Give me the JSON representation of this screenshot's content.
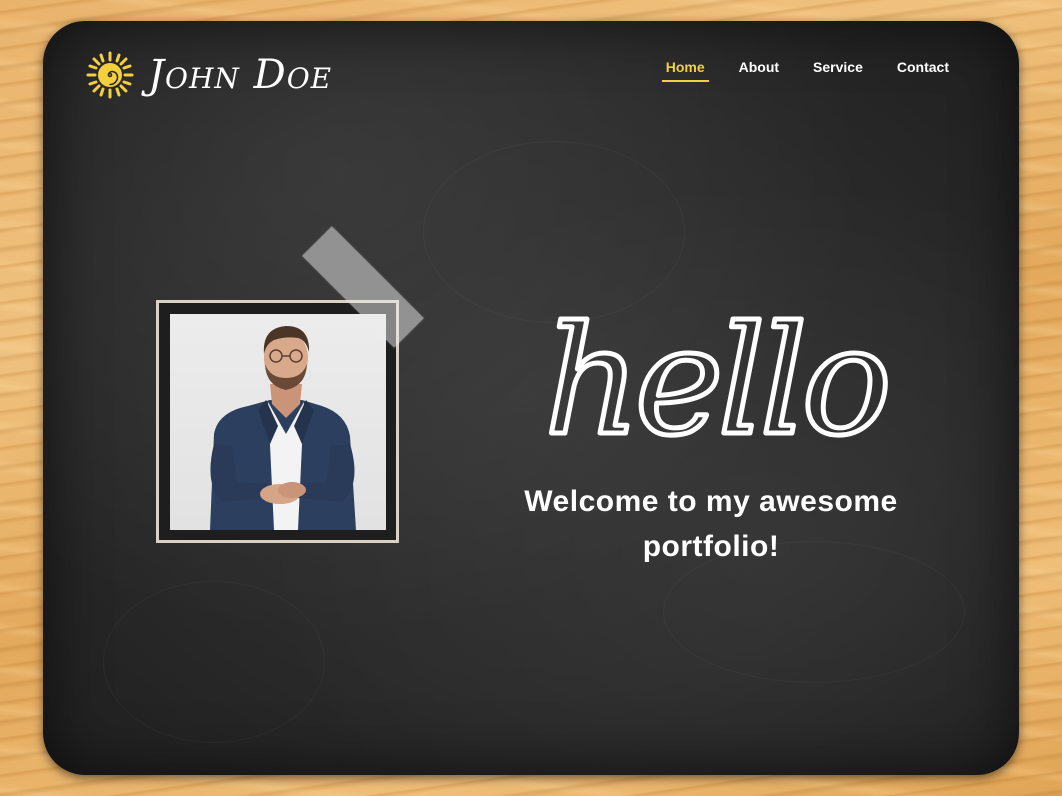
{
  "brand": {
    "name": "John Doe",
    "icon": "sun-spiral-icon",
    "icon_color": "#f4d03f"
  },
  "nav": {
    "items": [
      {
        "label": "Home",
        "active": true
      },
      {
        "label": "About",
        "active": false
      },
      {
        "label": "Service",
        "active": false
      },
      {
        "label": "Contact",
        "active": false
      }
    ],
    "active_color": "#f4d03f"
  },
  "hero": {
    "hello": "hello",
    "welcome": "Welcome to my awesome portfolio!",
    "photo_icon": "portrait-photo"
  },
  "colors": {
    "chalkboard": "#2a2a2a",
    "wood": "#e9b36c",
    "text": "#ffffff",
    "accent": "#f4d03f"
  }
}
